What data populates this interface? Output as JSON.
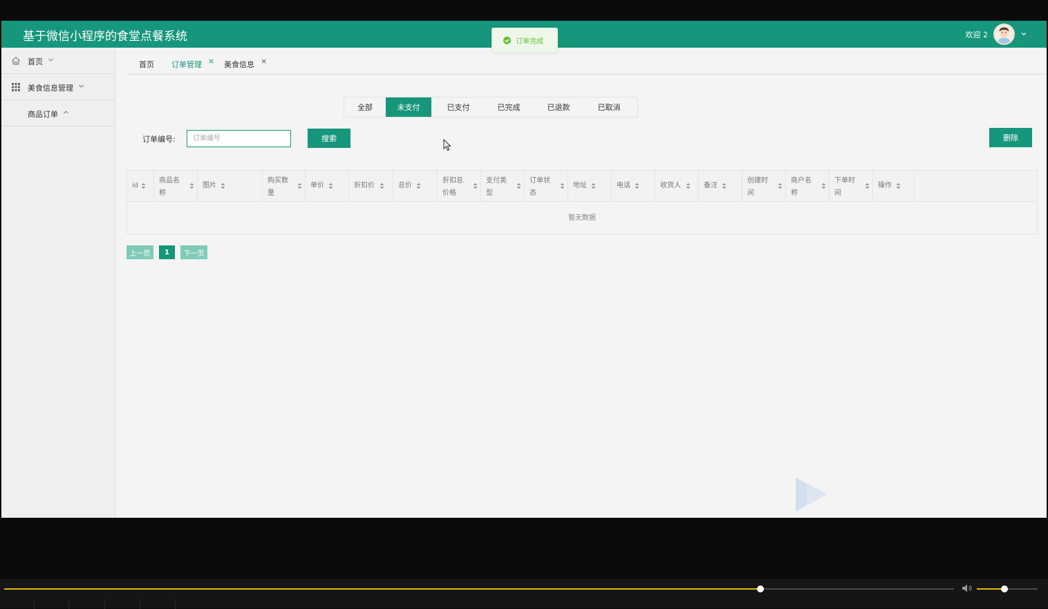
{
  "header": {
    "title": "基于微信小程序的食堂点餐系统",
    "welcome": "欢迎 2"
  },
  "toast": {
    "text": "订单完成",
    "color": "#67c23a"
  },
  "sidebar": {
    "items": [
      {
        "label": "首页",
        "icon": "home-icon"
      },
      {
        "label": "美食信息管理",
        "icon": "grid-icon"
      },
      {
        "label": "商品订单",
        "icon": ""
      }
    ]
  },
  "tabs": [
    {
      "label": "首页",
      "active": false,
      "closable": false
    },
    {
      "label": "订单管理",
      "active": true,
      "closable": true
    },
    {
      "label": "美食信息",
      "active": false,
      "closable": true
    }
  ],
  "status_tabs": [
    "全部",
    "未支付",
    "已支付",
    "已完成",
    "已退款",
    "已取消"
  ],
  "status_active": "未支付",
  "search": {
    "label": "订单编号:",
    "placeholder": "订单编号",
    "value": "",
    "button": "搜索"
  },
  "delete_button": "删除",
  "table": {
    "columns": [
      [
        "id"
      ],
      [
        "商品名",
        "称"
      ],
      [
        "图片"
      ],
      [
        "购买数",
        "量"
      ],
      [
        "单价"
      ],
      [
        "折扣价"
      ],
      [
        "总价"
      ],
      [
        "折扣总",
        "价格"
      ],
      [
        "支付类",
        "型"
      ],
      [
        "订单状",
        "态"
      ],
      [
        "地址"
      ],
      [
        "电话"
      ],
      [
        "收货人"
      ],
      [
        "备注"
      ],
      [
        "创建时",
        "间"
      ],
      [
        "商户名",
        "称"
      ],
      [
        "下单时",
        "间"
      ],
      [
        "操作"
      ]
    ],
    "empty_text": "暂无数据"
  },
  "pagination": {
    "prev": "上一页",
    "current": "1",
    "next": "下一页"
  },
  "player": {
    "progress": 0.796,
    "volume": 0.45
  },
  "colors": {
    "primary": "#16967b",
    "primary_light": "#7fcbb8",
    "toast_bg": "#eef7ea"
  }
}
